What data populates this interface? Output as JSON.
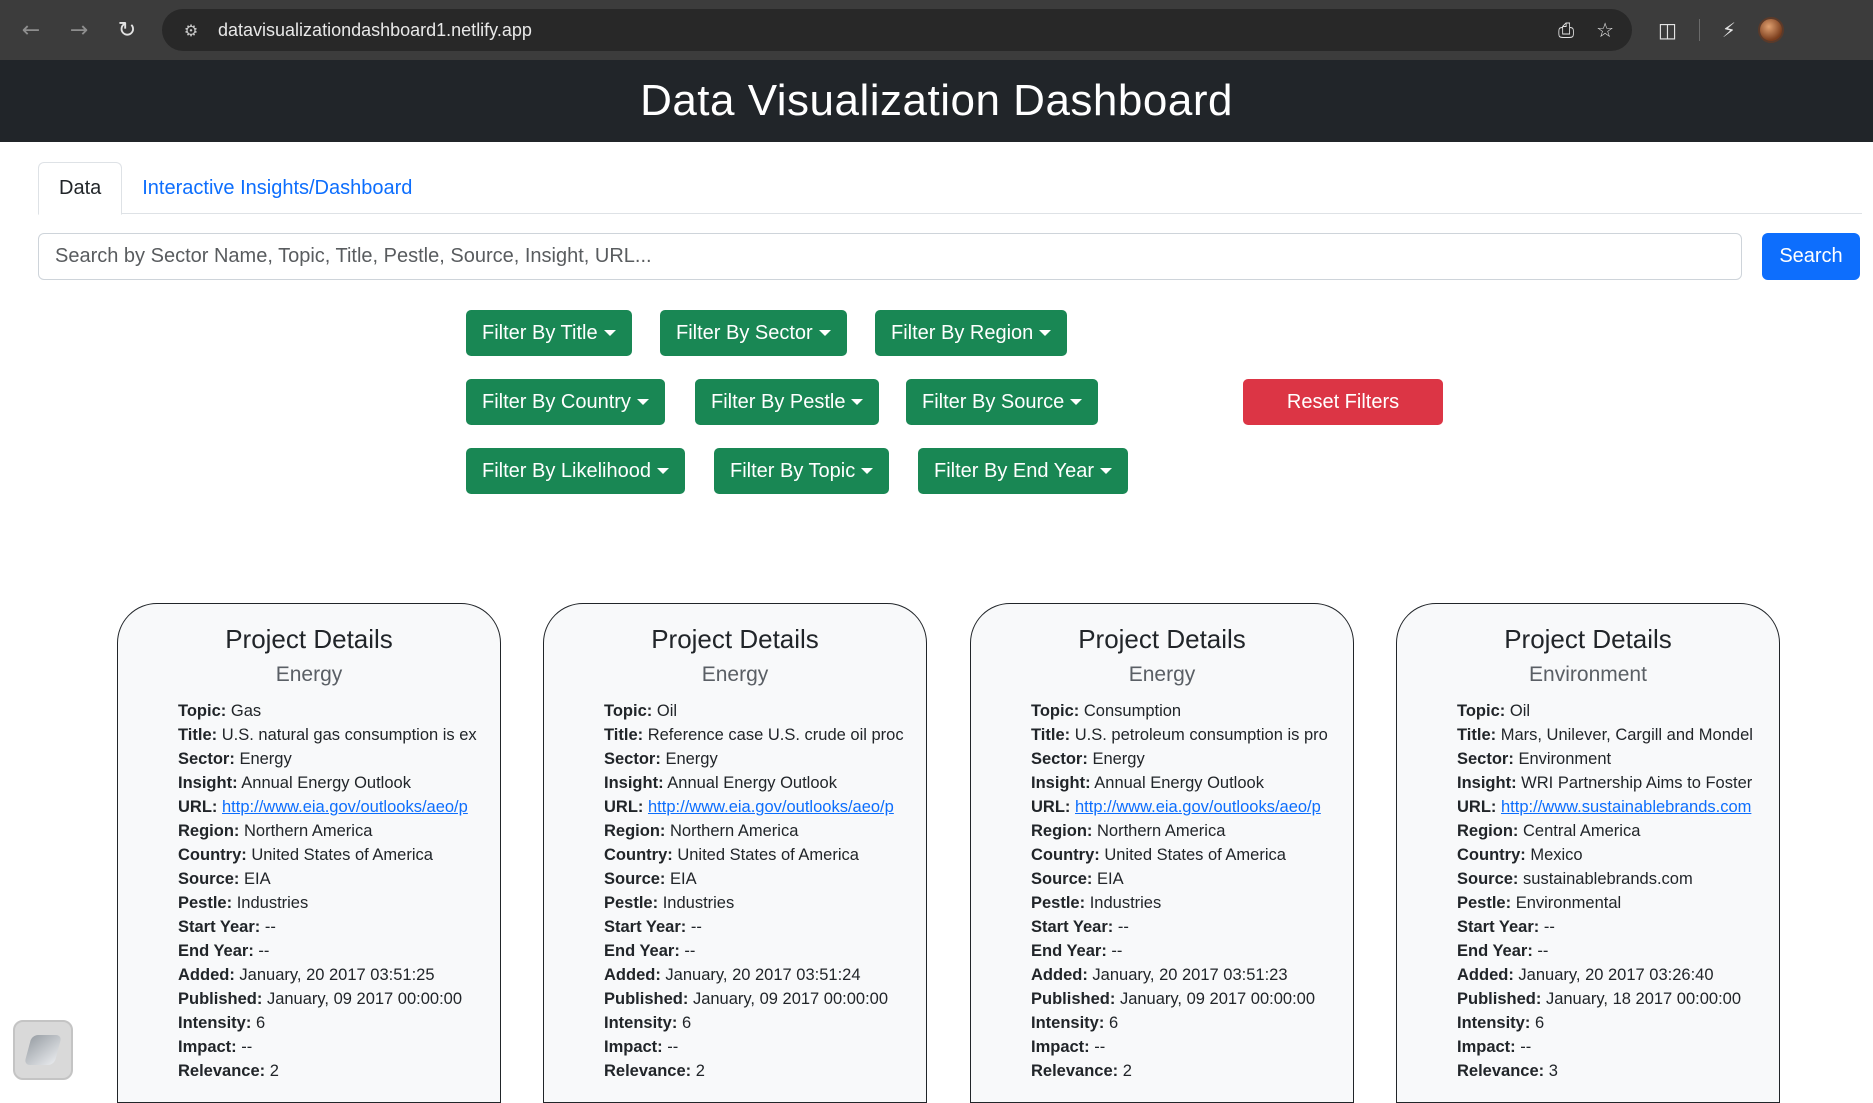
{
  "browser": {
    "url": "datavisualizationdashboard1.netlify.app"
  },
  "header": {
    "title": "Data Visualization Dashboard"
  },
  "tabs": [
    {
      "label": "Data",
      "active": true
    },
    {
      "label": "Interactive Insights/Dashboard",
      "active": false
    }
  ],
  "search": {
    "placeholder": "Search by Sector Name, Topic, Title, Pestle, Source, Insight, URL...",
    "button_label": "Search"
  },
  "filters": {
    "title": "Filter By Title",
    "sector": "Filter By Sector",
    "region": "Filter By Region",
    "country": "Filter By Country",
    "pestle": "Filter By Pestle",
    "source": "Filter By Source",
    "likelihood": "Filter By Likelihood",
    "topic": "Filter By Topic",
    "end_year": "Filter By End Year",
    "reset": "Reset Filters"
  },
  "colors": {
    "filter": "#198754",
    "reset": "#dc3545",
    "primary": "#0d6efd",
    "header_bg": "#212529"
  },
  "field_labels": {
    "topic": "Topic:",
    "title": "Title:",
    "sector": "Sector:",
    "insight": "Insight:",
    "url": "URL:",
    "region": "Region:",
    "country": "Country:",
    "source": "Source:",
    "pestle": "Pestle:",
    "start_year": "Start Year:",
    "end_year": "End Year:",
    "added": "Added:",
    "published": "Published:",
    "intensity": "Intensity:",
    "impact": "Impact:",
    "relevance": "Relevance:"
  },
  "cards": [
    {
      "heading": "Project Details",
      "subtitle": "Energy",
      "topic": "Gas",
      "title": "U.S. natural gas consumption is ex",
      "sector": "Energy",
      "insight": "Annual Energy Outlook",
      "url": "http://www.eia.gov/outlooks/aeo/p",
      "region": "Northern America",
      "country": "United States of America",
      "source": "EIA",
      "pestle": "Industries",
      "start_year": "--",
      "end_year": "--",
      "added": "January, 20 2017 03:51:25",
      "published": "January, 09 2017 00:00:00",
      "intensity": "6",
      "impact": "--",
      "relevance": "2"
    },
    {
      "heading": "Project Details",
      "subtitle": "Energy",
      "topic": "Oil",
      "title": "Reference case U.S. crude oil proc",
      "sector": "Energy",
      "insight": "Annual Energy Outlook",
      "url": "http://www.eia.gov/outlooks/aeo/p",
      "region": "Northern America",
      "country": "United States of America",
      "source": "EIA",
      "pestle": "Industries",
      "start_year": "--",
      "end_year": "--",
      "added": "January, 20 2017 03:51:24",
      "published": "January, 09 2017 00:00:00",
      "intensity": "6",
      "impact": "--",
      "relevance": "2"
    },
    {
      "heading": "Project Details",
      "subtitle": "Energy",
      "topic": "Consumption",
      "title": "U.S. petroleum consumption is pro",
      "sector": "Energy",
      "insight": "Annual Energy Outlook",
      "url": "http://www.eia.gov/outlooks/aeo/p",
      "region": "Northern America",
      "country": "United States of America",
      "source": "EIA",
      "pestle": "Industries",
      "start_year": "--",
      "end_year": "--",
      "added": "January, 20 2017 03:51:23",
      "published": "January, 09 2017 00:00:00",
      "intensity": "6",
      "impact": "--",
      "relevance": "2"
    },
    {
      "heading": "Project Details",
      "subtitle": "Environment",
      "topic": "Oil",
      "title": "Mars, Unilever, Cargill and Mondel",
      "sector": "Environment",
      "insight": "WRI Partnership Aims to Foster",
      "url": "http://www.sustainablebrands.com",
      "region": "Central America",
      "country": "Mexico",
      "source": "sustainablebrands.com",
      "pestle": "Environmental",
      "start_year": "--",
      "end_year": "--",
      "added": "January, 20 2017 03:26:40",
      "published": "January, 18 2017 00:00:00",
      "intensity": "6",
      "impact": "--",
      "relevance": "3"
    }
  ]
}
